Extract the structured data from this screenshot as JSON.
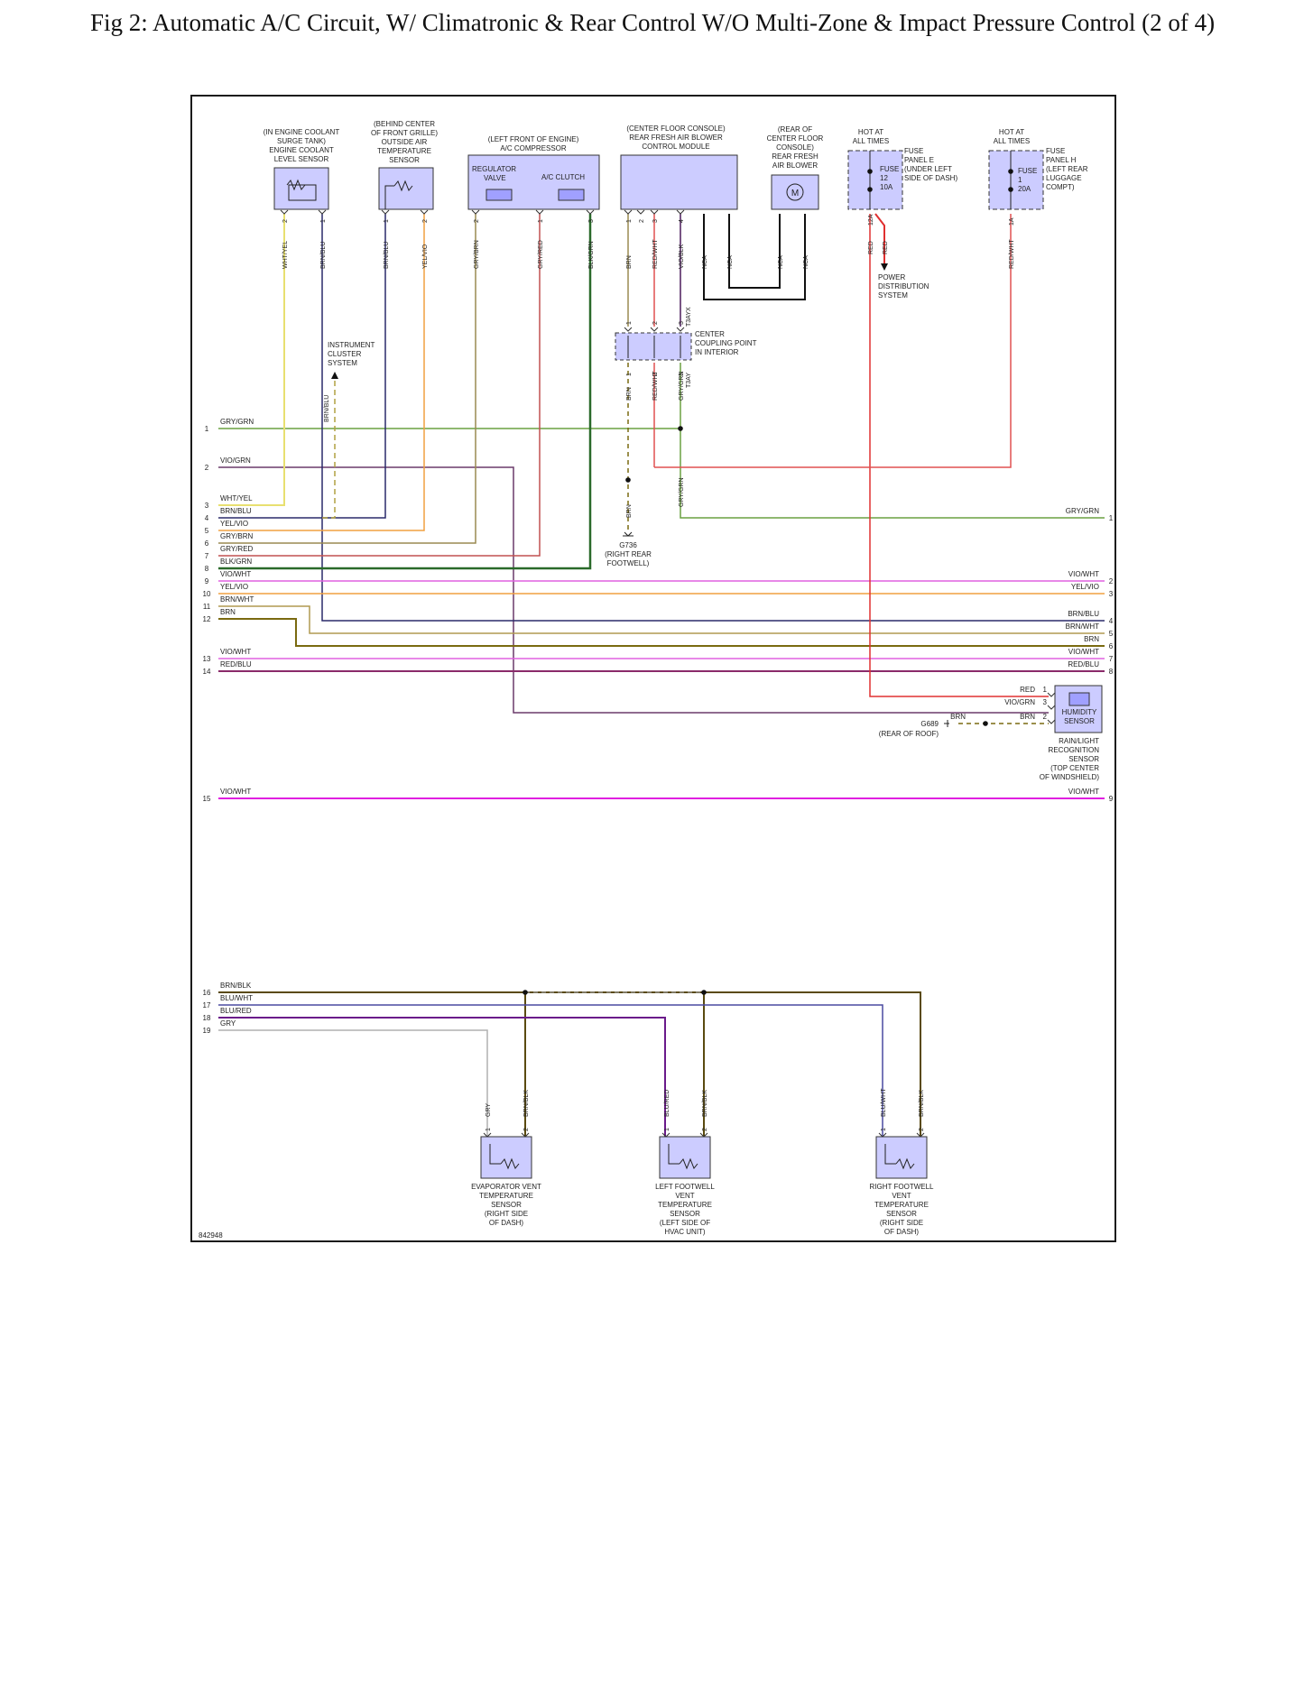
{
  "title": "Fig 2: Automatic A/C Circuit, W/ Climatronic & Rear Control W/O Multi-Zone & Impact Pressure Control (2 of 4)",
  "diagram_id": "842948",
  "components": {
    "coolant_sensor": {
      "label": [
        "(IN ENGINE COOLANT",
        "SURGE TANK)",
        "ENGINE COOLANT",
        "LEVEL SENSOR"
      ],
      "pins": [
        "2",
        "1"
      ],
      "wires": [
        "WHT/YEL",
        "BRN/BLU"
      ]
    },
    "air_temp_sensor": {
      "label": [
        "(BEHIND CENTER",
        "OF FRONT GRILLE)",
        "OUTSIDE AIR",
        "TEMPERATURE",
        "SENSOR"
      ],
      "pins": [
        "1",
        "2"
      ],
      "wires": [
        "BRN/BLU",
        "YEL/VIO"
      ]
    },
    "compressor": {
      "label": [
        "(LEFT FRONT OF ENGINE)",
        "A/C COMPRESSOR"
      ],
      "parts": [
        "REGULATOR",
        "VALVE",
        "A/C CLUTCH"
      ],
      "pins": [
        "2",
        "1",
        "3"
      ],
      "wires": [
        "GRY/BRN",
        "GRY/RED",
        "BLK/GRN"
      ]
    },
    "blower_module": {
      "label": [
        "(CENTER FLOOR CONSOLE)",
        "REAR FRESH AIR BLOWER",
        "CONTROL MODULE"
      ],
      "pins": [
        "1",
        "2",
        "3",
        "4"
      ],
      "wires": [
        "BRN",
        "RED/WHT",
        "VIO/BLK",
        "NCA",
        "NCA"
      ]
    },
    "rear_blower": {
      "label": [
        "(REAR OF",
        "CENTER FLOOR",
        "CONSOLE)",
        "REAR FRESH",
        "AIR BLOWER"
      ],
      "symbol": "M",
      "wires": [
        "NCA",
        "NCA"
      ]
    },
    "fuse_e": {
      "hot": [
        "HOT AT",
        "ALL TIMES"
      ],
      "fuse": [
        "FUSE",
        "12",
        "10A"
      ],
      "label": [
        "FUSE",
        "PANEL E",
        "(UNDER LEFT",
        "SIDE OF DASH)"
      ],
      "pin": "12A",
      "wires": [
        "RED",
        "RED"
      ],
      "dest": [
        "POWER",
        "DISTRIBUTION",
        "SYSTEM"
      ]
    },
    "fuse_h": {
      "hot": [
        "HOT AT",
        "ALL TIMES"
      ],
      "fuse": [
        "FUSE",
        "1",
        "20A"
      ],
      "label": [
        "FUSE",
        "PANEL H",
        "(LEFT REAR",
        "LUGGAGE",
        "COMPT)"
      ],
      "pin": "1A",
      "wires": [
        "RED/WHT"
      ]
    },
    "coupling": {
      "label": [
        "CENTER",
        "COUPLING POINT",
        "IN INTERIOR"
      ],
      "top_pins": [
        "1",
        "2",
        "3"
      ],
      "top_conn": "T3AYX",
      "bottom_pins": [
        "1",
        "2",
        "3"
      ],
      "bottom_conn": "T3AY",
      "bottom_wires": [
        "BRN",
        "RED/WHT",
        "GRY/GRN"
      ]
    },
    "instrument": {
      "label": [
        "INSTRUMENT",
        "CLUSTER",
        "SYSTEM"
      ],
      "wire": "BRN/BLU"
    },
    "ground_g736": {
      "wire": "BRN",
      "label": [
        "G736",
        "(RIGHT REAR",
        "FOOTWELL)"
      ]
    },
    "wire_gry_grn": "GRY/GRN",
    "humidity": {
      "name": [
        "HUMIDITY",
        "SENSOR"
      ],
      "label": [
        "RAIN/LIGHT",
        "RECOGNITION",
        "SENSOR",
        "(TOP CENTER",
        "OF WINDSHIELD)"
      ],
      "pins": [
        {
          "wire": "RED",
          "pin": "1"
        },
        {
          "wire": "VIO/GRN",
          "pin": "3"
        },
        {
          "wire": "BRN",
          "pin": "2"
        }
      ]
    },
    "ground_g689": {
      "wire": "BRN",
      "label": [
        "G689",
        "(REAR OF ROOF)"
      ]
    },
    "evap_sensor": {
      "label": [
        "EVAPORATOR VENT",
        "TEMPERATURE",
        "SENSOR",
        "(RIGHT SIDE",
        "OF DASH)"
      ],
      "pins": [
        "1",
        "2"
      ],
      "wires": [
        "GRY",
        "BRN/BLK"
      ]
    },
    "left_foot_sensor": {
      "label": [
        "LEFT FOOTWELL",
        "VENT",
        "TEMPERATURE",
        "SENSOR",
        "(LEFT SIDE OF",
        "HVAC UNIT)"
      ],
      "pins": [
        "1",
        "2"
      ],
      "wires": [
        "BLU/RED",
        "BRN/BLK"
      ]
    },
    "right_foot_sensor": {
      "label": [
        "RIGHT FOOTWELL",
        "VENT",
        "TEMPERATURE",
        "SENSOR",
        "(RIGHT SIDE",
        "OF DASH)"
      ],
      "pins": [
        "1",
        "2"
      ],
      "wires": [
        "BLU/WHT",
        "BRN/BLK"
      ]
    }
  },
  "left_terminals": [
    {
      "num": "1",
      "wire": "GRY/GRN"
    },
    {
      "num": "2",
      "wire": "VIO/GRN"
    },
    {
      "num": "3",
      "wire": "WHT/YEL"
    },
    {
      "num": "4",
      "wire": "BRN/BLU"
    },
    {
      "num": "5",
      "wire": "YEL/VIO"
    },
    {
      "num": "6",
      "wire": "GRY/BRN"
    },
    {
      "num": "7",
      "wire": "GRY/RED"
    },
    {
      "num": "8",
      "wire": "BLK/GRN"
    },
    {
      "num": "9",
      "wire": "VIO/WHT"
    },
    {
      "num": "10",
      "wire": "YEL/VIO"
    },
    {
      "num": "11",
      "wire": "BRN/WHT"
    },
    {
      "num": "12",
      "wire": "BRN"
    },
    {
      "num": "13",
      "wire": "VIO/WHT"
    },
    {
      "num": "14",
      "wire": "RED/BLU"
    },
    {
      "num": "15",
      "wire": "VIO/WHT"
    },
    {
      "num": "16",
      "wire": "BRN/BLK"
    },
    {
      "num": "17",
      "wire": "BLU/WHT"
    },
    {
      "num": "18",
      "wire": "BLU/RED"
    },
    {
      "num": "19",
      "wire": "GRY"
    }
  ],
  "right_terminals": [
    {
      "num": "1",
      "wire": "GRY/GRN"
    },
    {
      "num": "2",
      "wire": "VIO/WHT"
    },
    {
      "num": "3",
      "wire": "YEL/VIO"
    },
    {
      "num": "4",
      "wire": "BRN/BLU"
    },
    {
      "num": "5",
      "wire": "BRN/WHT"
    },
    {
      "num": "6",
      "wire": "BRN"
    },
    {
      "num": "7",
      "wire": "VIO/WHT"
    },
    {
      "num": "8",
      "wire": "RED/BLU"
    },
    {
      "num": "9",
      "wire": "VIO/WHT"
    }
  ],
  "colors": {
    "component_fill": "#ccccff",
    "wht_yel": "#e8e070",
    "brn_blu": "#2a2a6a",
    "yel_vio": "#f0a040",
    "gry_brn": "#9a8a50",
    "gry_red": "#c05050",
    "blk_grn": "#2a6a2a",
    "gry_grn": "#6aa040",
    "vio_grn": "#6a3a6a",
    "vio_wht": "#e060e0",
    "brn_wht": "#b09a50",
    "brn": "#7a6a10",
    "red_blu": "#8a2a6a",
    "red": "#e03030",
    "red_wht": "#e05050",
    "vio_blk": "#4a1a5a",
    "blu_red": "#6a1a8a",
    "blu_wht": "#4a4aa0",
    "brn_blk": "#5a4a10",
    "gry": "#b0b0b0",
    "nca": "#111111"
  }
}
